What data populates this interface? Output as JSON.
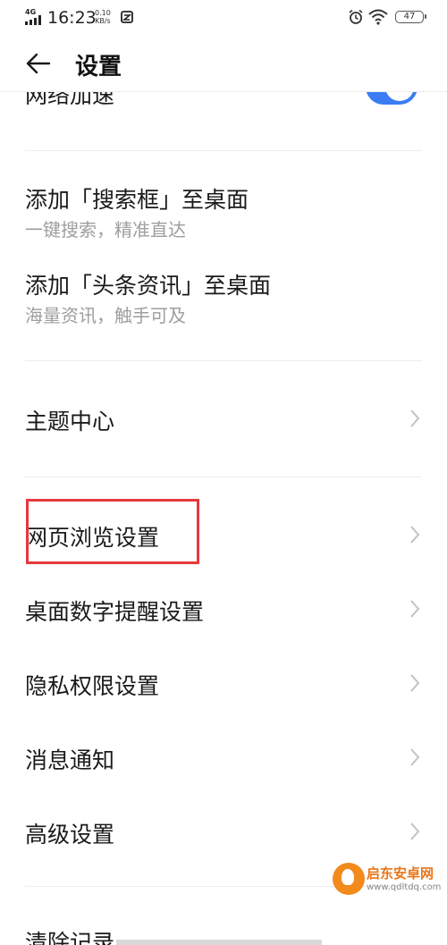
{
  "status_bar": {
    "network": "4G",
    "time": "16:23",
    "speed_value": "0.10",
    "speed_unit": "KB/s",
    "battery": "47"
  },
  "header": {
    "title": "设置"
  },
  "settings": {
    "network_accel": {
      "label": "网络加速",
      "enabled": true
    },
    "add_search_box": {
      "label": "添加「搜索框」至桌面",
      "subtitle": "一键搜索，精准直达"
    },
    "add_news": {
      "label": "添加「头条资讯」至桌面",
      "subtitle": "海量资讯，触手可及"
    },
    "theme_center": {
      "label": "主题中心"
    },
    "web_browse": {
      "label": "网页浏览设置"
    },
    "desktop_badge": {
      "label": "桌面数字提醒设置"
    },
    "privacy": {
      "label": "隐私权限设置"
    },
    "notifications": {
      "label": "消息通知"
    },
    "advanced": {
      "label": "高级设置"
    },
    "clear_history": {
      "label": "清除记录"
    }
  },
  "watermark": {
    "name": "启东安卓网",
    "url": "www.qdltdq.com"
  },
  "colors": {
    "toggle_on": "#3b7cf4",
    "highlight": "#e4393c"
  }
}
